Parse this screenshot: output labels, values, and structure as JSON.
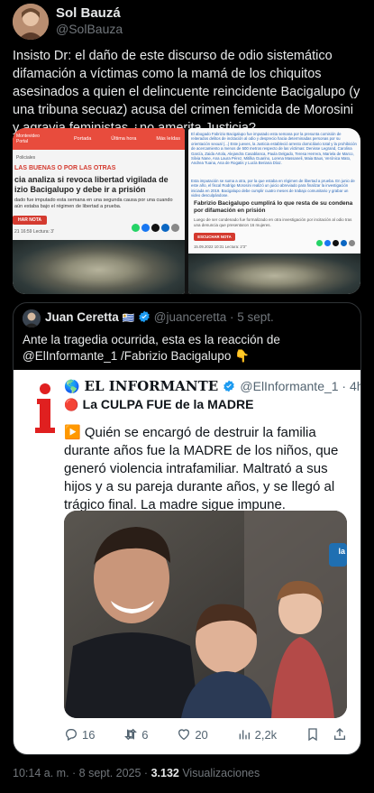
{
  "post": {
    "author_name": "Sol Bauzá",
    "author_handle": "@SolBauza",
    "text": "Insisto Dr: el daño de este discurso de odio sistemático difamación a víctimas como la mamá de los chiquitos asesinados a quien el delincuente reincidente Bacigalupo (y una tribuna secuaz) acusa del crimen femicida de Morosini y agravia feministas ¿no amerita Justicia?",
    "timestamp": "10:14 a. m. · 8 sept. 2025 · ",
    "views_count": "3.132",
    "views_label": " Visualizaciones"
  },
  "image_left": {
    "brand_line1": "Montevideo",
    "brand_line2": "Portal",
    "nav": [
      "Portada",
      "Última hora",
      "Más leídas"
    ],
    "breadcrumb": "Policiales",
    "kicker": "LAS BUENAS O POR LAS OTRAS",
    "headline": "cia analiza si revoca libertad vigilada de izio Bacigalupo y debe ir a prisión",
    "lede": "dado fue imputado esta semana en una segunda causa por una cuando aún estaba bajo el régimen de libertad a prueba.",
    "button": "HAR NOTA",
    "meta": "21 16:59   Lectura: 3'"
  },
  "image_right": {
    "top_text": "El abogado Fabrizio Bacigalupo fue imputado esta semana por la presunta comisión de reiterados delitos de incitación al odio y desprecio hacia determinadas personas por su orientación sexual (...) Este jueves, la Justicia estableció arresto domiciliario total y la prohibición de acercamiento a menos de 500 metros respecto de las víctimas: Denisse Legrand, Carolina García, Zaida Artola, Alejandra Casablanca, Paula Delgado, Teresa Herrera, Mariela de Marco, Silvia Nane, Ana Laura Pérez, Mitilka Guarino, Lorena Massaneli, Maia Baus, Verónica Mato, Andrea Tuana, Ana de Rogatis y Lucía Beriana Díaz.",
    "mid_text": "Esta imputación se suma a otra, por la que estaba en régimen de libertad a prueba. En junio de este año, el fiscal Rodrigo Morosini realizó un juicio abreviado para finalizar la investigación iniciada en 2019. Bacigalupo debe cumplir cuatro meses de trabajo comunitario y grabar un video desculpándose.",
    "headline": "Fabrizio Bacigalupo cumplirá lo que resta de su condena por difamación en prisión",
    "lede": "Luego de ser condenado fue formalizado en otra investigación por incitación al odio tras una denuncia que presentaron 16 mujeres.",
    "button": "ESCUCHAR NOTA",
    "meta": "15.09.2022 10:31   Lectura: 2'3\""
  },
  "quote": {
    "author_name": "Juan Ceretta",
    "flag": "🇺🇾",
    "author_handle": "@juanceretta · 5 sept.",
    "text": "Ante la tragedia ocurrida, esta es la reacción de @ElInformante_1 /Fabrizio Bacigalupo 👇"
  },
  "embedded": {
    "logo_letter": "i",
    "globe": "🌎",
    "name": "EL INFORMANTE",
    "handle": "@ElInformante_1 · 4h",
    "red_dot": "🔴",
    "headline": "La CULPA FUE de la MADRE",
    "play": "▶️",
    "text": "Quién se encargó de destruir la familia durante años fue la MADRE de los niños, que generó violencia intrafamiliar. Maltrató a sus hijos y a su pareja durante años, y se llegó al trágico final. La madre sigue impune.",
    "photo_badge": "la",
    "actions": {
      "replies": "16",
      "reposts": "6",
      "likes": "20",
      "views": "2,2k"
    }
  },
  "colors": {
    "background": "#000000",
    "link": "#1d9bf0",
    "divider": "#2f3336",
    "muted": "#71767b"
  }
}
